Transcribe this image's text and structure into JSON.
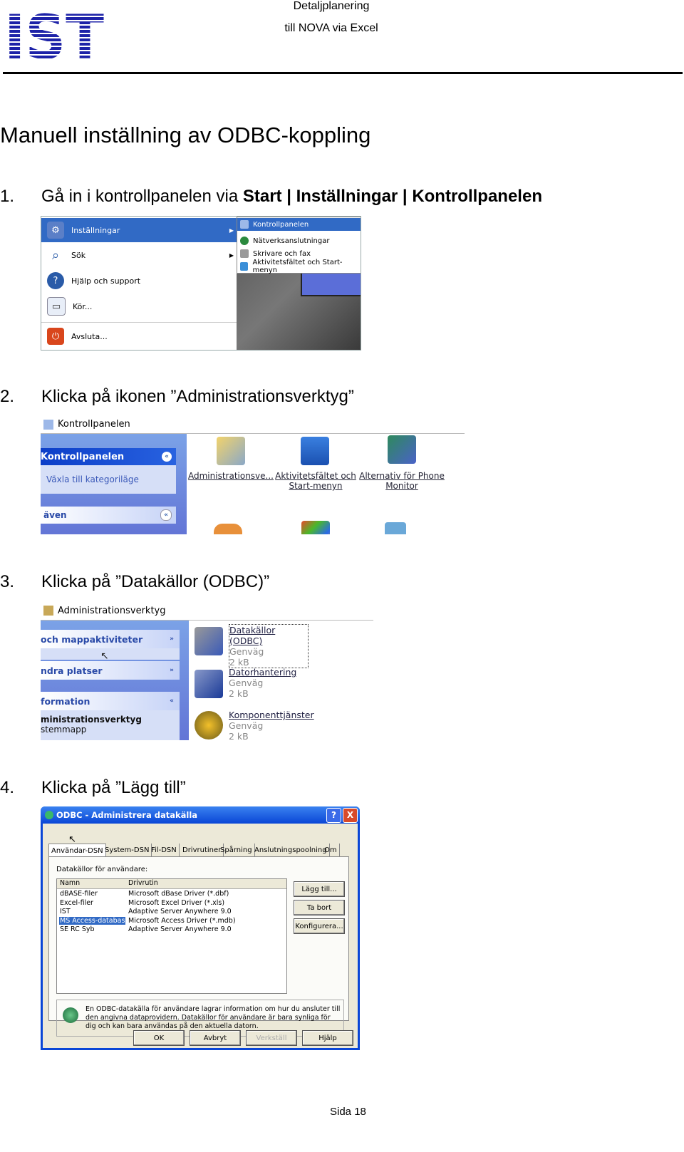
{
  "header": {
    "logo_text": "IST",
    "line1": "Detaljplanering",
    "line2": "till NOVA via Excel"
  },
  "title": "Manuell inställning av ODBC-koppling",
  "steps": [
    {
      "num": "1.",
      "text_plain": "Gå in i kontrollpanelen via ",
      "text_bold": "Start | Inställningar | Kontrollpanelen"
    },
    {
      "num": "2.",
      "text_plain": "Klicka på ikonen ”Administrationsverktyg”"
    },
    {
      "num": "3.",
      "text_plain": "Klicka på ”Datakällor (ODBC)”"
    },
    {
      "num": "4.",
      "text_plain": "Klicka på ”Lägg till”"
    }
  ],
  "shot1": {
    "items": [
      "Inställningar",
      "Sök",
      "Hjälp och support",
      "Kör...",
      "Avsluta..."
    ],
    "submenu": [
      "Kontrollpanelen",
      "Nätverksanslutningar",
      "Skrivare och fax",
      "Aktivitetsfältet och Start-menyn"
    ]
  },
  "shot2": {
    "window_title": "Kontrollpanelen",
    "panel_title": "Kontrollpanelen",
    "panel_link": "Växla till kategoriläge",
    "panel2_title": "även",
    "icons": [
      {
        "label": "Administrationsve..."
      },
      {
        "label": "Aktivitetsfältet och Start-menyn"
      },
      {
        "label": "Alternativ för Phone Monitor"
      }
    ]
  },
  "shot3": {
    "window_title": "Administrationsverktyg",
    "panel_items": [
      "och mappaktiviteter",
      "ndra platser",
      "formation"
    ],
    "folder_title": "ministrationsverktyg",
    "folder_sub": "stemmapp",
    "files": [
      {
        "name": "Datakällor (ODBC)",
        "type": "Genväg",
        "size": "2 kB"
      },
      {
        "name": "Datorhantering",
        "type": "Genväg",
        "size": "2 kB"
      },
      {
        "name": "Komponenttjänster",
        "type": "Genväg",
        "size": "2 kB"
      }
    ]
  },
  "shot4": {
    "window_title": "ODBC - Administrera datakälla",
    "title_buttons": [
      "?",
      "X"
    ],
    "tabs": [
      "Användar-DSN",
      "System-DSN",
      "Fil-DSN",
      "Drivrutiner",
      "Spårning",
      "Anslutningspoolning",
      "Om"
    ],
    "group_label": "Datakällor för användare:",
    "columns": [
      "Namn",
      "Drivrutin"
    ],
    "rows": [
      [
        "dBASE-filer",
        "Microsoft dBase Driver (*.dbf)"
      ],
      [
        "Excel-filer",
        "Microsoft Excel Driver (*.xls)"
      ],
      [
        "IST",
        "Adaptive Server Anywhere 9.0"
      ],
      [
        "MS Access-databas",
        "Microsoft Access Driver (*.mdb)"
      ],
      [
        "SE RC Syb",
        "Adaptive Server Anywhere 9.0"
      ]
    ],
    "side_buttons": [
      "Lägg till...",
      "Ta bort",
      "Konfigurera..."
    ],
    "info_text": "En ODBC-datakälla för användare lagrar information om hur du ansluter till den angivna dataprovidern. Datakällor för användare är bara synliga för dig och kan bara användas på den aktuella datorn.",
    "bottom_buttons": [
      "OK",
      "Avbryt",
      "Verkställ",
      "Hjälp"
    ]
  },
  "footer": "Sida 18"
}
